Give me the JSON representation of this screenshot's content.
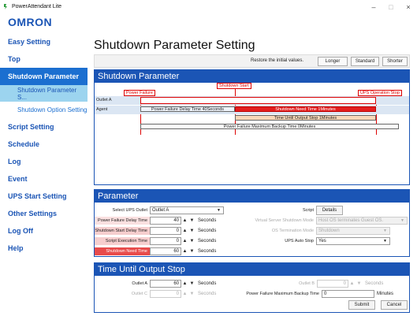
{
  "window": {
    "title": "PowerAttendant Lite",
    "minimize": "–",
    "maximize": "□",
    "close": "×"
  },
  "brand": "OMRON",
  "nav": {
    "easy_setting": "Easy Setting",
    "top": "Top",
    "shutdown_parameter": "Shutdown Parameter",
    "shutdown_parameter_sub": "Shutdown Parameter S...",
    "shutdown_option": "Shutdown Option Setting",
    "script_setting": "Script Setting",
    "schedule": "Schedule",
    "log": "Log",
    "event": "Event",
    "ups_start": "UPS Start Setting",
    "other": "Other Settings",
    "logoff": "Log Off",
    "help": "Help"
  },
  "page_title": "Shutdown Parameter Setting",
  "topbar": {
    "restore_label": "Restore the initial values.",
    "longer": "Longer",
    "standard": "Standard",
    "shorter": "Shorter"
  },
  "timeline": {
    "title": "Shutdown Parameter",
    "power_failure": "Power Failure",
    "shutdown_start": "Shutdown Start",
    "ups_operation_stop": "UPS Operation Stop",
    "outlet_a": "Outlet A",
    "agent": "Agent",
    "delay_bar": "Power Failure Delay Time 40Seconds",
    "need_bar": "Shutdown Need Time 1Minutes",
    "until_stop_bar": "Time Until Output Stop 1Minutes",
    "max_backup_bar": "Power Failure Maximum Backup Time 0Minutes"
  },
  "parameter": {
    "title": "Parameter",
    "select_outlet_label": "Select UPS Outlet",
    "select_outlet_value": "Outlet A",
    "script_label": "Script",
    "details": "Details",
    "pf_delay_label": "Power Failure Delay Time",
    "pf_delay_value": "40",
    "ss_delay_label": "Shutdown Start Delay Time",
    "ss_delay_value": "0",
    "script_exec_label": "Script Execution Time",
    "script_exec_value": "0",
    "need_label": "Shutdown Need Time",
    "need_value": "60",
    "seconds": "Seconds",
    "vs_mode_label": "Virtual Server Shutdown Mode",
    "vs_mode_value": "Host OS terminates Guest OS.",
    "os_mode_label": "OS Termination Mode",
    "os_mode_value": "Shutdown",
    "auto_stop_label": "UPS Auto Stop",
    "auto_stop_value": "Yes"
  },
  "output_stop": {
    "title": "Time Until Output Stop",
    "outlet_a_label": "Outlet A",
    "outlet_a_value": "60",
    "outlet_b_label": "Outlet B",
    "outlet_b_value": "0",
    "outlet_c_label": "Outlet C",
    "outlet_c_value": "0",
    "seconds": "Seconds",
    "max_backup_label": "Power Failure Maximum Backup Time",
    "max_backup_value": "0",
    "minutes": "Minutes",
    "submit": "Submit",
    "cancel": "Cancel"
  },
  "colors": {
    "accent": "#1b55b5",
    "active": "#1b6fd0",
    "sub_selected": "#9cd4ef",
    "red": "#e84b4b",
    "peach": "#f8d7b8"
  }
}
